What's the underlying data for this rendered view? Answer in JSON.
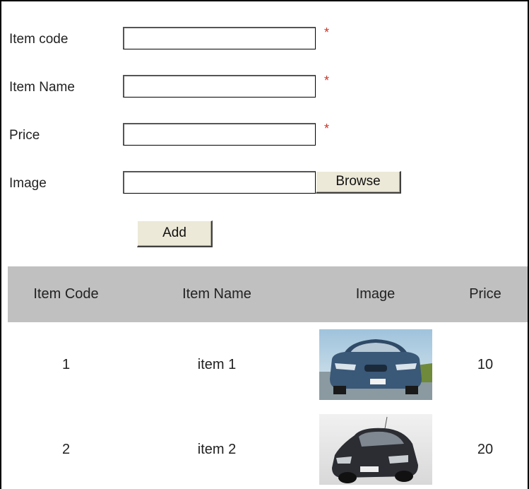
{
  "form": {
    "fields": [
      {
        "label": "Item code",
        "value": "",
        "required_mark": "*"
      },
      {
        "label": "Item Name",
        "value": "",
        "required_mark": "*"
      },
      {
        "label": "Price",
        "value": "",
        "required_mark": "*"
      }
    ],
    "image": {
      "label": "Image",
      "browse_label": "Browse"
    },
    "add_label": "Add"
  },
  "table": {
    "headers": [
      "Item Code",
      "Item Name",
      "Image",
      "Price"
    ],
    "rows": [
      {
        "code": "1",
        "name": "item 1",
        "price": "10"
      },
      {
        "code": "2",
        "name": "item 2",
        "price": "20"
      }
    ]
  }
}
